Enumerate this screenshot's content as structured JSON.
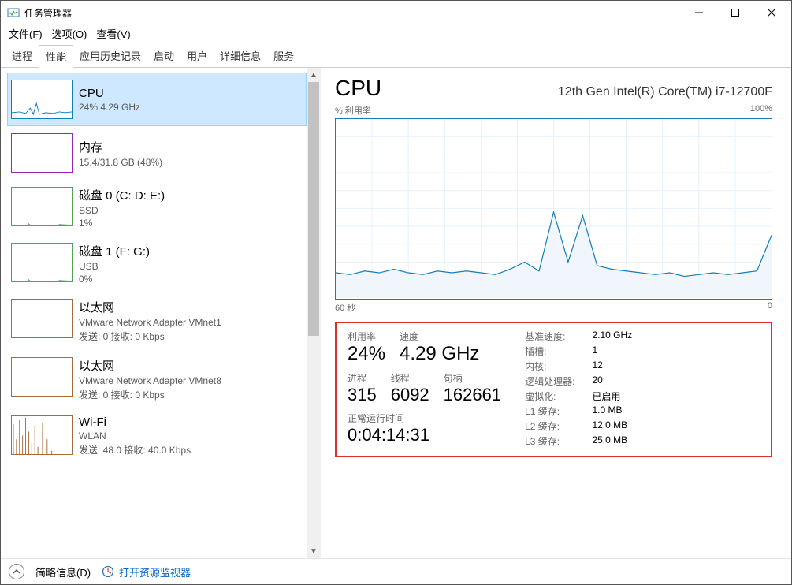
{
  "window": {
    "title": "任务管理器"
  },
  "menu": {
    "file": "文件(F)",
    "options": "选项(O)",
    "view": "查看(V)"
  },
  "tabs": [
    "进程",
    "性能",
    "应用历史记录",
    "启动",
    "用户",
    "详细信息",
    "服务"
  ],
  "activeTab": 1,
  "sidebar": [
    {
      "title": "CPU",
      "sub": "24%  4.29 GHz",
      "kind": "cpu",
      "selected": true
    },
    {
      "title": "内存",
      "sub": "15.4/31.8 GB (48%)",
      "kind": "mem"
    },
    {
      "title": "磁盘 0 (C: D: E:)",
      "sub": "SSD",
      "sub2": "1%",
      "kind": "disk"
    },
    {
      "title": "磁盘 1 (F: G:)",
      "sub": "USB",
      "sub2": "0%",
      "kind": "disk"
    },
    {
      "title": "以太网",
      "sub": "VMware Network Adapter VMnet1",
      "sub2": "发送: 0  接收: 0 Kbps",
      "kind": "net"
    },
    {
      "title": "以太网",
      "sub": "VMware Network Adapter VMnet8",
      "sub2": "发送: 0  接收: 0 Kbps",
      "kind": "net"
    },
    {
      "title": "Wi-Fi",
      "sub": "WLAN",
      "sub2": "发送: 48.0  接收: 40.0 Kbps",
      "kind": "wifi"
    }
  ],
  "panel": {
    "title": "CPU",
    "model": "12th Gen Intel(R) Core(TM) i7-12700F",
    "chart": {
      "ylabel": "% 利用率",
      "ymax": "100%",
      "xlabel_left": "60 秒",
      "xlabel_right": "0"
    },
    "stats": {
      "util_lbl": "利用率",
      "util": "24%",
      "speed_lbl": "速度",
      "speed": "4.29 GHz",
      "proc_lbl": "进程",
      "proc": "315",
      "thread_lbl": "线程",
      "thread": "6092",
      "handle_lbl": "句柄",
      "handle": "162661",
      "uptime_lbl": "正常运行时间",
      "uptime": "0:04:14:31"
    },
    "right": [
      {
        "k": "基准速度:",
        "v": "2.10 GHz"
      },
      {
        "k": "插槽:",
        "v": "1"
      },
      {
        "k": "内核:",
        "v": "12"
      },
      {
        "k": "逻辑处理器:",
        "v": "20"
      },
      {
        "k": "虚拟化:",
        "v": "已启用"
      },
      {
        "k": "L1 缓存:",
        "v": "1.0 MB"
      },
      {
        "k": "L2 缓存:",
        "v": "12.0 MB"
      },
      {
        "k": "L3 缓存:",
        "v": "25.0 MB"
      }
    ]
  },
  "footer": {
    "brief": "简略信息(D)",
    "monitor": "打开资源监视器"
  },
  "chart_data": {
    "type": "line",
    "title": "% 利用率",
    "ylabel": "% 利用率",
    "ylim": [
      0,
      100
    ],
    "x": [
      60,
      58,
      56,
      54,
      52,
      50,
      48,
      46,
      44,
      42,
      40,
      38,
      36,
      34,
      32,
      30,
      28,
      26,
      24,
      22,
      20,
      18,
      16,
      14,
      12,
      10,
      8,
      6,
      4,
      2,
      0
    ],
    "values": [
      14,
      13,
      15,
      14,
      16,
      14,
      13,
      15,
      14,
      15,
      14,
      13,
      16,
      20,
      15,
      48,
      20,
      46,
      18,
      16,
      15,
      14,
      13,
      14,
      12,
      13,
      14,
      13,
      14,
      15,
      35
    ]
  }
}
